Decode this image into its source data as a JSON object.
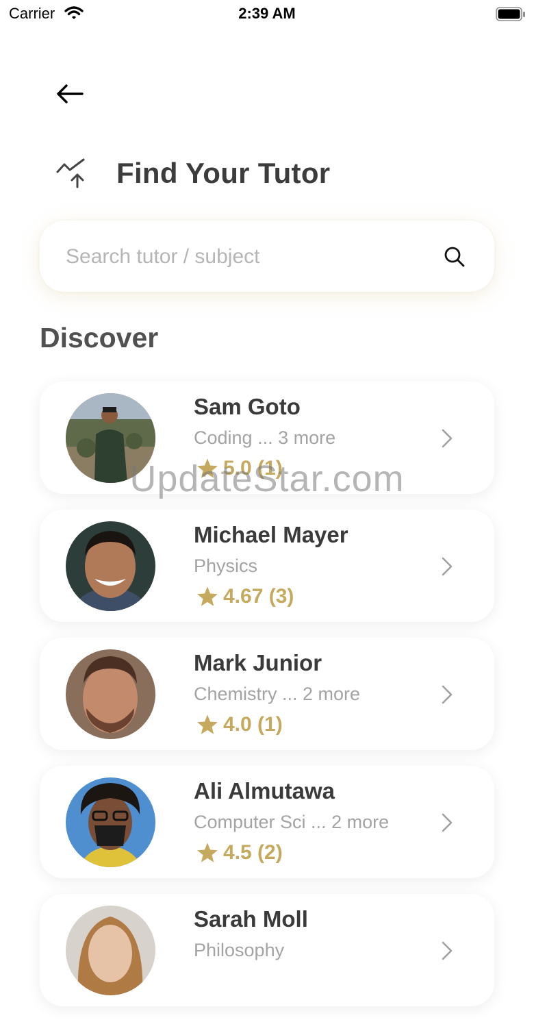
{
  "status_bar": {
    "carrier": "Carrier",
    "time": "2:39 AM"
  },
  "header": {
    "title": "Find Your Tutor"
  },
  "search": {
    "placeholder": "Search tutor / subject",
    "value": ""
  },
  "section": {
    "title": "Discover"
  },
  "tutors": [
    {
      "name": "Sam Goto",
      "subject": "Coding ... 3 more",
      "rating": "5.0 (1)"
    },
    {
      "name": "Michael Mayer",
      "subject": "Physics",
      "rating": "4.67 (3)"
    },
    {
      "name": "Mark Junior",
      "subject": "Chemistry ... 2 more",
      "rating": "4.0 (1)"
    },
    {
      "name": "Ali Almutawa",
      "subject": "Computer Sci ... 2 more",
      "rating": "4.5 (2)"
    },
    {
      "name": "Sarah Moll",
      "subject": "Philosophy",
      "rating": ""
    }
  ],
  "watermark": "UpdateStar.com",
  "colors": {
    "accent_gold": "#c5a95e",
    "title_text": "#3c3c3c",
    "muted_text": "#a3a3a3"
  }
}
